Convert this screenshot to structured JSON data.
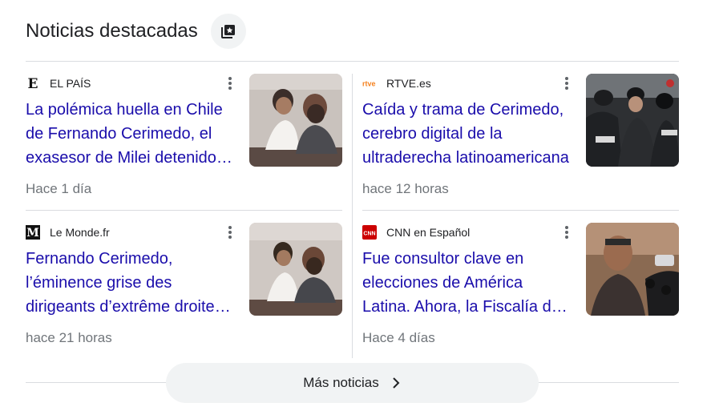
{
  "header": {
    "title": "Noticias destacadas",
    "icon": "saved-stories-icon"
  },
  "cards": [
    {
      "source": "EL PAÍS",
      "logo_icon": "el-pais-logo",
      "headline": "La polémica huella en Chile de Fernando Cerimedo, el exasesor de Milei detenido por ser el cerebro de una red",
      "time": "Hace 1 día",
      "thumb_icon": "photo-two-men-behind-glass"
    },
    {
      "source": "RTVE.es",
      "logo_icon": "rtve-logo",
      "headline": "Caída y trama de Cerimedo, cerebro digital de la ultraderecha latinoamericana",
      "time": "hace 12 horas",
      "thumb_icon": "photo-police-escort"
    },
    {
      "source": "Le Monde.fr",
      "logo_icon": "le-monde-logo",
      "headline": "Fernando Cerimedo, l’éminence grise des dirigeants d’extrême droite d’Amérique latine",
      "time": "hace 21 horas",
      "thumb_icon": "photo-two-men-behind-glass"
    },
    {
      "source": "CNN en Español",
      "logo_icon": "cnn-logo",
      "headline": "Fue consultor clave en elecciones de América Latina. Ahora, la Fiscalía de Chile lo acusa",
      "time": "Hace 4 días",
      "thumb_icon": "photo-man-with-microphones"
    }
  ],
  "more_news": {
    "label": "Más noticias",
    "icon": "chevron-right-icon"
  },
  "colors": {
    "headline": "#1a0dab",
    "meta": "#70757a",
    "divider": "#dadce0",
    "pill": "#f1f3f4",
    "rtve_orange": "#f58220",
    "cnn_red": "#cc0000"
  }
}
